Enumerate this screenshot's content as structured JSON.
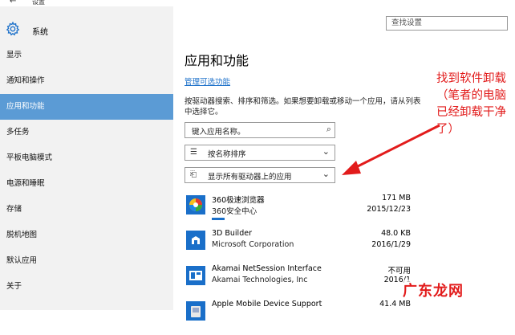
{
  "window": {
    "title": "设置",
    "back": "←"
  },
  "header": {
    "label": "系统",
    "search_placeholder": "查找设置"
  },
  "sidebar": {
    "items": [
      {
        "label": "显示"
      },
      {
        "label": "通知和操作"
      },
      {
        "label": "应用和功能",
        "active": true
      },
      {
        "label": "多任务"
      },
      {
        "label": "平板电脑模式"
      },
      {
        "label": "电源和睡眠"
      },
      {
        "label": "存储"
      },
      {
        "label": "脱机地图"
      },
      {
        "label": "默认应用"
      },
      {
        "label": "关于"
      }
    ]
  },
  "main": {
    "title": "应用和功能",
    "manage_link": "管理可选功能",
    "description": "按驱动器搜索、排序和筛选。如果想要卸载或移动一个应用，请从列表中选择它。",
    "search_placeholder": "键入应用名称。",
    "sort_label": "按名称排序",
    "drive_label": "显示所有驱动器上的应用"
  },
  "apps": [
    {
      "name": "360极速浏览器",
      "publisher": "360安全中心",
      "size": "171 MB",
      "date": "2015/12/23",
      "icon": "360-browser-icon"
    },
    {
      "name": "3D Builder",
      "publisher": "Microsoft Corporation",
      "size": "48.0 KB",
      "date": "2016/1/29",
      "icon": "3d-builder-icon"
    },
    {
      "name": "Akamai NetSession Interface",
      "publisher": "Akamai Technologies, Inc",
      "size": "不可用",
      "date": "2016/1",
      "icon": "akamai-icon"
    },
    {
      "name": "Apple Mobile Device Support",
      "publisher": "",
      "size": "41.4 MB",
      "date": "",
      "icon": "apple-mobile-icon"
    }
  ],
  "annotation": {
    "text": "找到软件卸载（笔者的电脑已经卸载干净了）",
    "color": "#e21b1b"
  },
  "watermark": "广东龙网",
  "colors": {
    "accent": "#5b9bd5",
    "link": "#1a6fc9",
    "annotation": "#e21b1b"
  }
}
